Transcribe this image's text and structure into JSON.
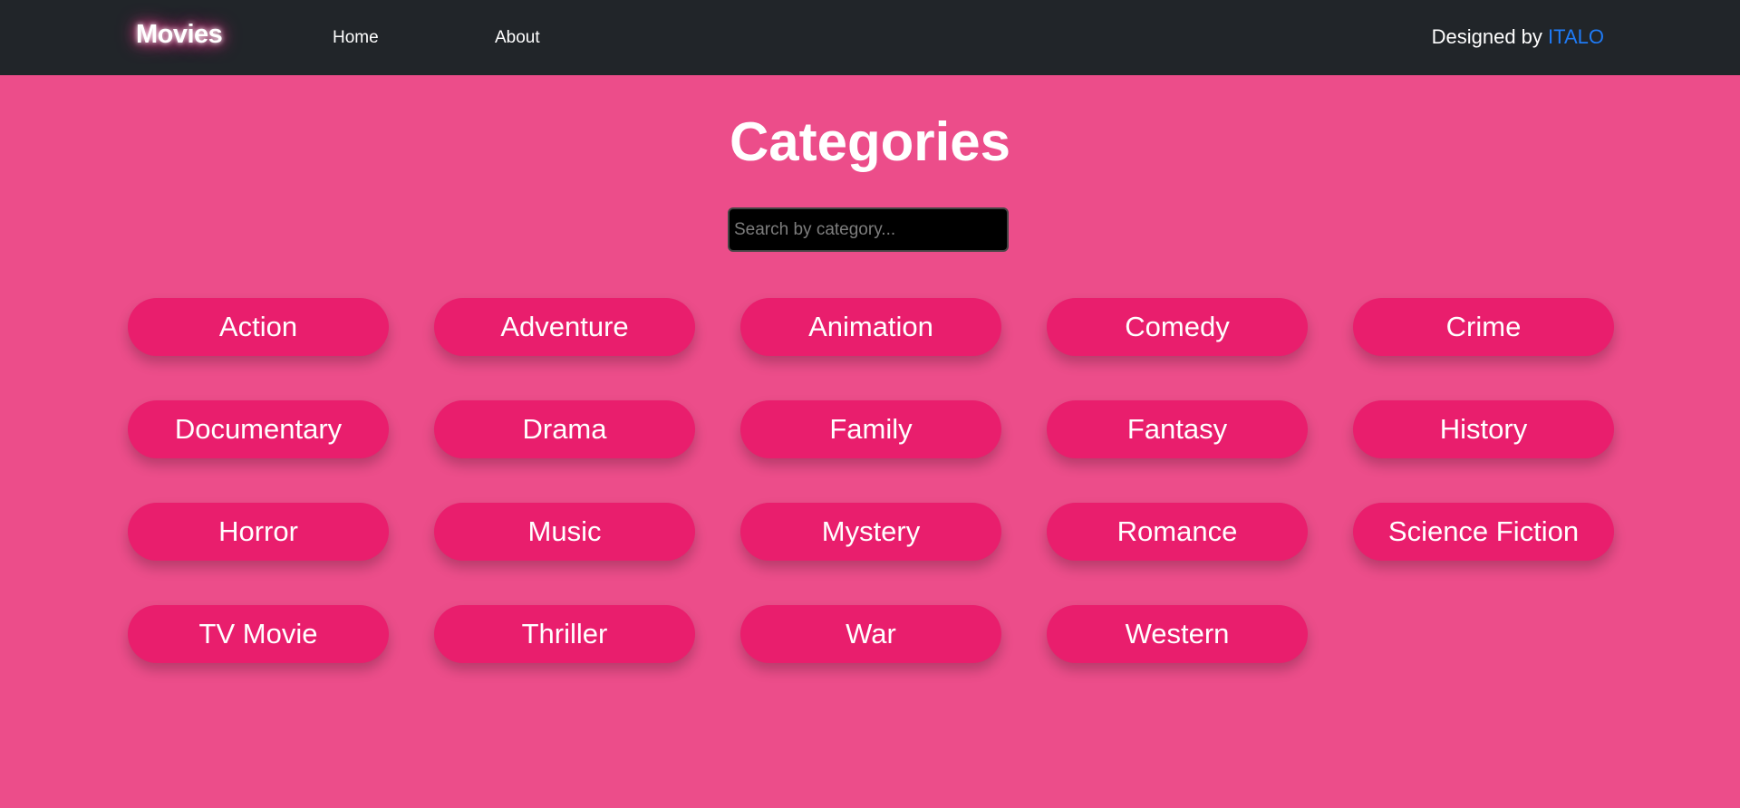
{
  "navbar": {
    "brand": "Movies",
    "links": [
      "Home",
      "About"
    ],
    "credit_prefix": "Designed by",
    "credit_name": "ITALO"
  },
  "main": {
    "title": "Categories",
    "search_placeholder": "Search by category...",
    "categories": [
      "Action",
      "Adventure",
      "Animation",
      "Comedy",
      "Crime",
      "Documentary",
      "Drama",
      "Family",
      "Fantasy",
      "History",
      "Horror",
      "Music",
      "Mystery",
      "Romance",
      "Science Fiction",
      "TV Movie",
      "Thriller",
      "War",
      "Western"
    ]
  },
  "colors": {
    "page_background": "#ec4d8a",
    "navbar_background": "#212529",
    "category_button": "#e91e6d",
    "credit_accent": "#1f7bf6"
  }
}
